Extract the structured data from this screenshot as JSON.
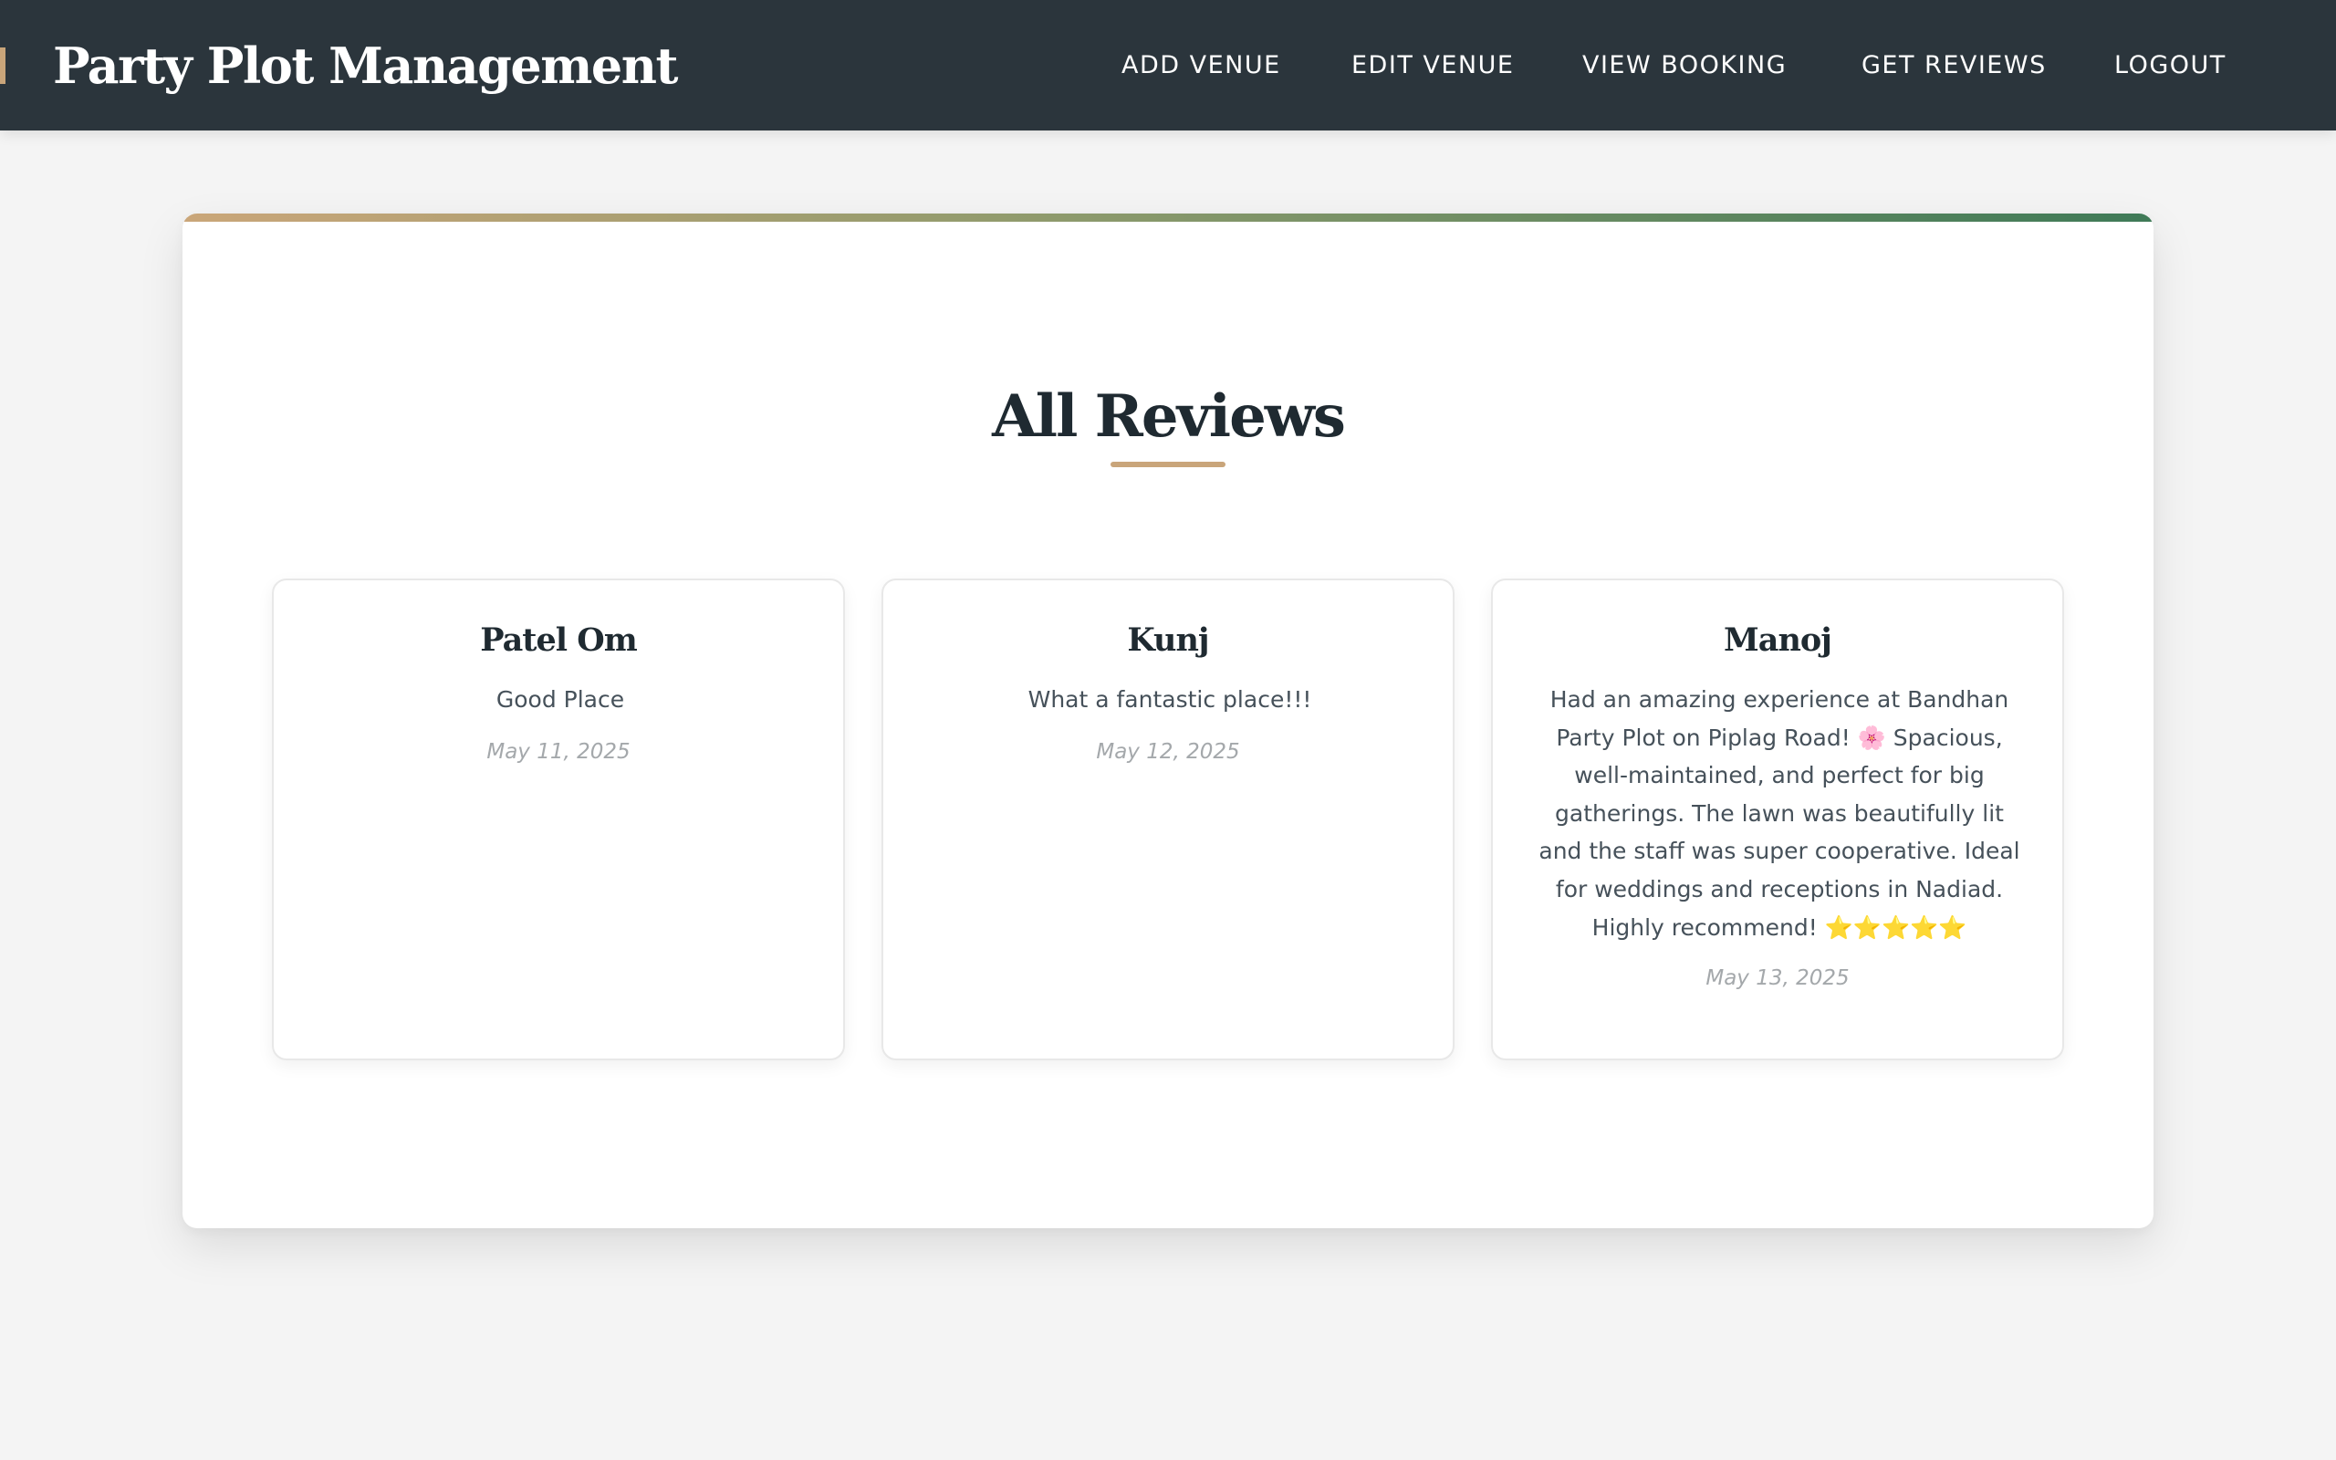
{
  "header": {
    "brand": "Party Plot Management",
    "nav": [
      {
        "label": "ADD VENUE"
      },
      {
        "label": "EDIT VENUE"
      },
      {
        "label": "VIEW BOOKING"
      },
      {
        "label": "GET REVIEWS"
      },
      {
        "label": "LOGOUT"
      }
    ]
  },
  "main": {
    "title": "All Reviews",
    "reviews": [
      {
        "name": "Patel Om",
        "text": "Good Place",
        "date": "May 11, 2025"
      },
      {
        "name": "Kunj",
        "text": "What a fantastic place!!!",
        "date": "May 12, 2025"
      },
      {
        "name": "Manoj",
        "text": "Had an amazing experience at Bandhan Party Plot on Piplag Road! 🌸 Spacious, well-maintained, and perfect for big gatherings. The lawn was beautifully lit and the staff was super cooperative. Ideal for weddings and receptions in Nadiad. Highly recommend! ⭐⭐⭐⭐⭐",
        "date": "May 13, 2025"
      }
    ]
  },
  "colors": {
    "header_bg": "#2b353c",
    "accent_gold": "#c9a57a",
    "accent_green": "#3f7a57",
    "page_bg": "#f4f4f4"
  }
}
